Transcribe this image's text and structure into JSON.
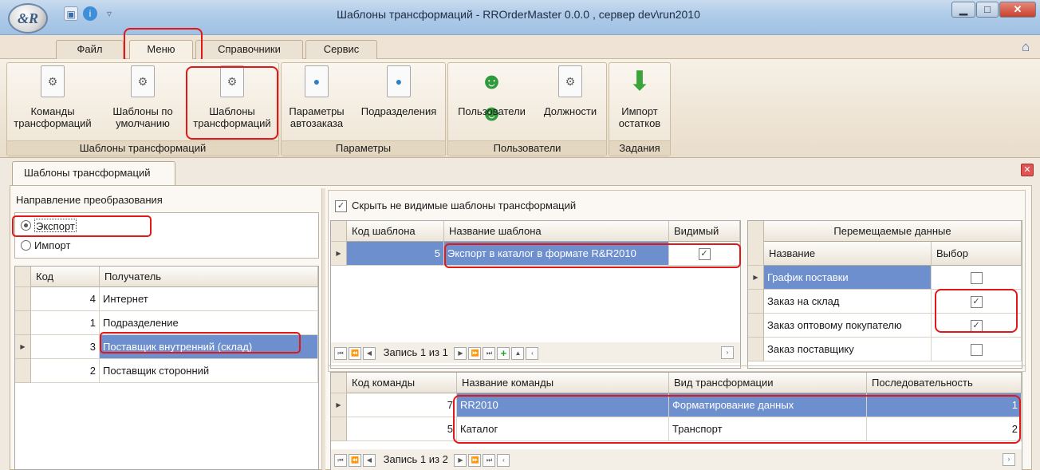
{
  "window": {
    "title": "Шаблоны трансформаций - RROrderMaster 0.0.0 , сервер dev\\run2010",
    "logo": "&R"
  },
  "tabs": [
    "Файл",
    "Меню",
    "Справочники",
    "Сервис"
  ],
  "ribbon": {
    "groups": [
      {
        "title": "Шаблоны трансформаций",
        "buttons": [
          {
            "line1": "Команды",
            "line2": "трансформаций",
            "icon": "gear-document-icon"
          },
          {
            "line1": "Шаблоны по",
            "line2": "умолчанию",
            "icon": "gear-document-icon"
          },
          {
            "line1": "Шаблоны",
            "line2": "трансформаций",
            "icon": "gear-document-icon"
          }
        ]
      },
      {
        "title": "Параметры",
        "buttons": [
          {
            "line1": "Параметры",
            "line2": "автозаказа",
            "icon": "document-icon"
          },
          {
            "line1": "Подразделения",
            "line2": "",
            "icon": "document-icon"
          }
        ]
      },
      {
        "title": "Пользователи",
        "buttons": [
          {
            "line1": "Пользователи",
            "line2": "",
            "icon": "users-icon"
          },
          {
            "line1": "Должности",
            "line2": "",
            "icon": "gear-document-icon"
          }
        ]
      },
      {
        "title": "Задания",
        "buttons": [
          {
            "line1": "Импорт",
            "line2": "остатков",
            "icon": "down-arrow-icon"
          }
        ]
      }
    ]
  },
  "doc_tab": "Шаблоны трансформаций",
  "direction": {
    "label": "Направление преобразования",
    "options": [
      "Экспорт",
      "Импорт"
    ],
    "selected": "Экспорт"
  },
  "recipients": {
    "headers": [
      "Код",
      "Получатель"
    ],
    "rows": [
      {
        "code": "4",
        "name": "Интернет"
      },
      {
        "code": "1",
        "name": "Подразделение"
      },
      {
        "code": "3",
        "name": "Поставщик внутренний (склад)"
      },
      {
        "code": "2",
        "name": "Поставщик сторонний"
      }
    ]
  },
  "hide_checkbox": {
    "label": "Скрыть не видимые шаблоны трансформаций",
    "checked": true
  },
  "templates": {
    "headers": [
      "Код шаблона",
      "Название шаблона",
      "Видимый"
    ],
    "rows": [
      {
        "code": "5",
        "name": "Экспорт в каталог в формате R&R2010",
        "visible": true
      }
    ],
    "nav": "Запись 1 из 1"
  },
  "moved_data": {
    "title": "Перемещаемые данные",
    "headers": [
      "Название",
      "Выбор"
    ],
    "rows": [
      {
        "name": "График поставки",
        "checked": false
      },
      {
        "name": "Заказ на склад",
        "checked": true
      },
      {
        "name": "Заказ оптовому покупателю",
        "checked": true
      },
      {
        "name": "Заказ поставщику",
        "checked": false
      }
    ]
  },
  "commands": {
    "headers": [
      "Код команды",
      "Название команды",
      "Вид трансформации",
      "Последовательность"
    ],
    "rows": [
      {
        "code": "7",
        "name": "RR2010",
        "type": "Форматирование данных",
        "seq": "1"
      },
      {
        "code": "5",
        "name": "Каталог",
        "type": "Транспорт",
        "seq": "2"
      }
    ],
    "nav": "Запись 1 из 2"
  }
}
